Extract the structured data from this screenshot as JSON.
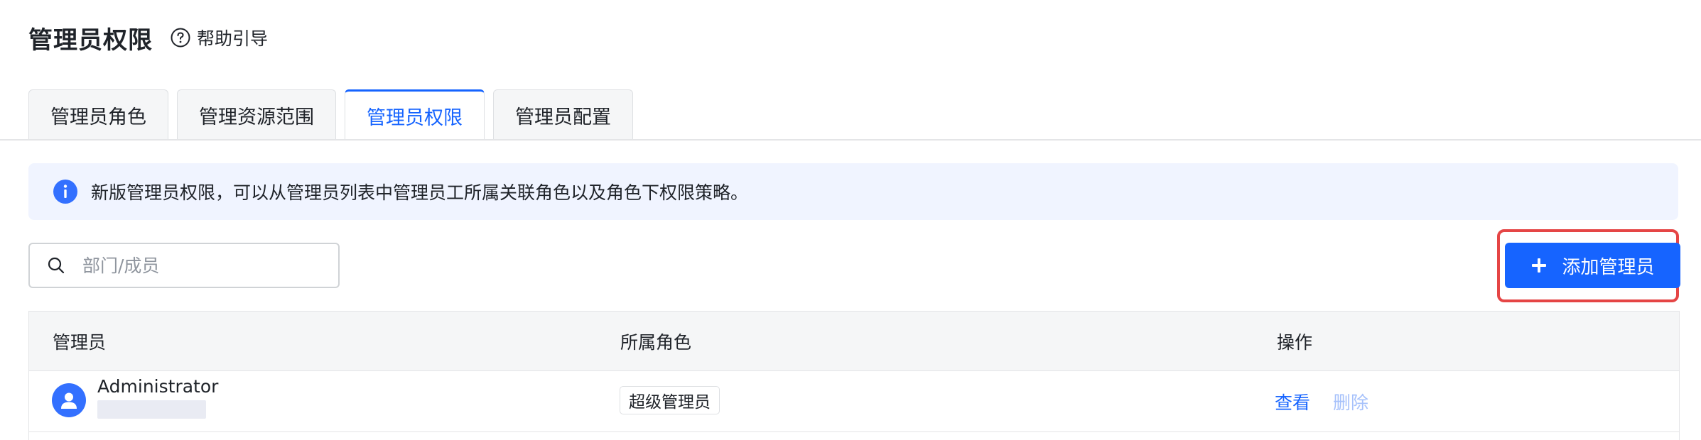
{
  "page": {
    "title": "管理员权限",
    "help_label": "帮助引导"
  },
  "tabs": [
    {
      "label": "管理员角色",
      "active": false
    },
    {
      "label": "管理资源范围",
      "active": false
    },
    {
      "label": "管理员权限",
      "active": true
    },
    {
      "label": "管理员配置",
      "active": false
    }
  ],
  "alert": {
    "text": "新版管理员权限，可以从管理员列表中管理员工所属关联角色以及角色下权限策略。"
  },
  "search": {
    "placeholder": "部门/成员",
    "value": ""
  },
  "toolbar": {
    "add_label": "添加管理员"
  },
  "table": {
    "headers": [
      "管理员",
      "所属角色",
      "操作"
    ],
    "rows": [
      {
        "name": "Administrator",
        "role": "超级管理员",
        "actions": {
          "view": "查看",
          "delete": "删除"
        }
      }
    ]
  },
  "colors": {
    "accent": "#1664ff",
    "highlight_frame": "#e54545",
    "alert_bg": "#f0f4ff",
    "disabled_link": "#a6c1fb"
  }
}
